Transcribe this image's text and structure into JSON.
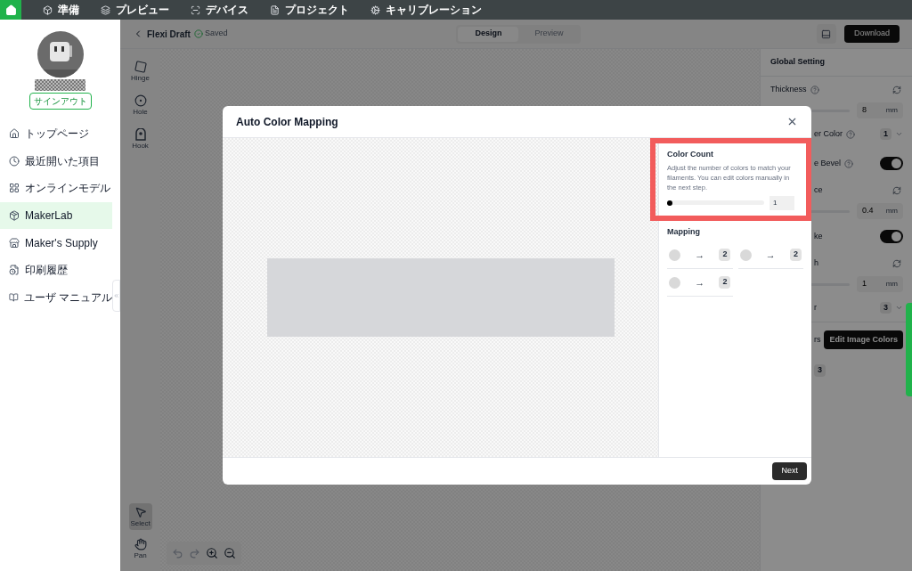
{
  "top_nav": [
    {
      "label": "準備"
    },
    {
      "label": "プレビュー"
    },
    {
      "label": "デバイス"
    },
    {
      "label": "プロジェクト"
    },
    {
      "label": "キャリブレーション"
    }
  ],
  "sidebar": {
    "sign_out": "サインアウト",
    "items": [
      {
        "label": "トップページ",
        "selected": false
      },
      {
        "label": "最近開いた項目",
        "selected": false
      },
      {
        "label": "オンラインモデル",
        "selected": false
      },
      {
        "label": "MakerLab",
        "selected": true
      },
      {
        "label": "Maker's Supply",
        "selected": false
      },
      {
        "label": "印刷履歴",
        "selected": false
      },
      {
        "label": "ユーザ マニュアル",
        "selected": false
      }
    ]
  },
  "header": {
    "title": "Flexi Draft",
    "status": "Saved",
    "tabs": [
      {
        "label": "Design",
        "selected": true
      },
      {
        "label": "Preview",
        "selected": false
      }
    ],
    "download": "Download"
  },
  "tools_top": [
    {
      "label": "Hinge"
    },
    {
      "label": "Hole"
    },
    {
      "label": "Hook"
    }
  ],
  "tools_bottom": [
    {
      "label": "Select",
      "selected": true
    },
    {
      "label": "Pan",
      "selected": false
    }
  ],
  "settings": {
    "title": "Global Setting",
    "rows": [
      {
        "kind": "label",
        "label": "Thickness"
      },
      {
        "kind": "input",
        "value": "8",
        "unit": "mm"
      },
      {
        "kind": "dropdown",
        "label": "er Color",
        "value": "1"
      },
      {
        "kind": "toggle",
        "label": "e Bevel",
        "on": true
      },
      {
        "kind": "label",
        "label": "ce"
      },
      {
        "kind": "input",
        "value": "0.4",
        "unit": "mm"
      },
      {
        "kind": "toggle",
        "label": "ke",
        "on": true
      },
      {
        "kind": "label",
        "label": "h"
      },
      {
        "kind": "input",
        "value": "1",
        "unit": "mm"
      },
      {
        "kind": "dropdown",
        "label": "r",
        "value": "3"
      },
      {
        "kind": "button",
        "label": "rs",
        "button": "Edit Image Colors"
      },
      {
        "kind": "badge",
        "value": "3"
      }
    ]
  },
  "modal": {
    "title": "Auto Color Mapping",
    "color_count": {
      "title": "Color Count",
      "description": "Adjust the number of colors to match your filaments. You can edit colors manually in the next step.",
      "level": 0,
      "value": "1"
    },
    "mapping": {
      "title": "Mapping",
      "items": [
        {
          "arrow": "→",
          "target": "2"
        },
        {
          "arrow": "→",
          "target": "2"
        },
        {
          "arrow": "→",
          "target": "2"
        }
      ]
    },
    "next": "Next"
  }
}
